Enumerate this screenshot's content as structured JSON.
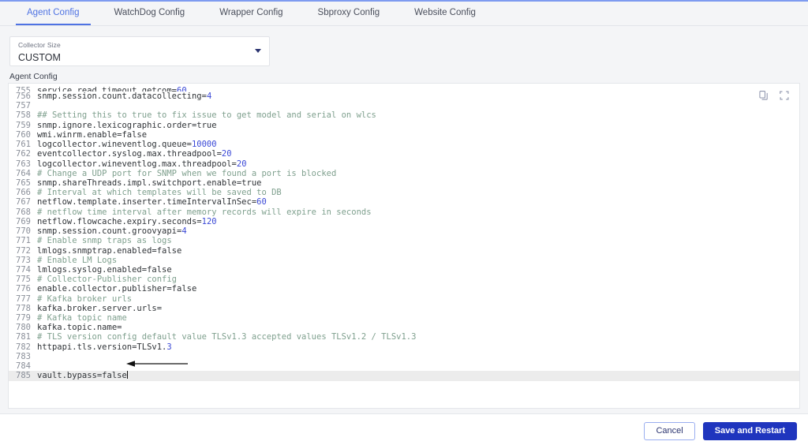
{
  "accent": {
    "blue": "#4f73e3",
    "primary_button": "#1f35be",
    "comment_green": "#7fa08e",
    "number_blue": "#3b49d6"
  },
  "tabs": [
    {
      "label": "Agent Config",
      "active": true
    },
    {
      "label": "WatchDog Config",
      "active": false
    },
    {
      "label": "Wrapper Config",
      "active": false
    },
    {
      "label": "Sbproxy Config",
      "active": false
    },
    {
      "label": "Website Config",
      "active": false
    }
  ],
  "collector_size": {
    "label": "Collector Size",
    "value": "CUSTOM",
    "options": [
      "CUSTOM"
    ]
  },
  "section": {
    "caption": "Agent Config"
  },
  "editor": {
    "tools": [
      {
        "name": "copy-icon",
        "title": "Copy"
      },
      {
        "name": "fullscreen-icon",
        "title": "Fullscreen"
      }
    ],
    "active_line": 785,
    "cursor_line": 785,
    "lines": [
      {
        "n": 755,
        "clipped": true,
        "segments": [
          {
            "t": "service.read_timeout_getcom=",
            "c": "code"
          },
          {
            "t": "60",
            "c": "num"
          }
        ]
      },
      {
        "n": 756,
        "segments": [
          {
            "t": "snmp.session.count.datacollecting=",
            "c": "code"
          },
          {
            "t": "4",
            "c": "num"
          }
        ]
      },
      {
        "n": 757,
        "segments": []
      },
      {
        "n": 758,
        "segments": [
          {
            "t": "## Setting this to true to fix issue to get model and serial on wlcs",
            "c": "cmt"
          }
        ]
      },
      {
        "n": 759,
        "segments": [
          {
            "t": "snmp.ignore.lexicographic.order=true",
            "c": "code"
          }
        ]
      },
      {
        "n": 760,
        "segments": [
          {
            "t": "wmi.winrm.enable=false",
            "c": "code"
          }
        ]
      },
      {
        "n": 761,
        "segments": [
          {
            "t": "logcollector.wineventlog.queue=",
            "c": "code"
          },
          {
            "t": "10000",
            "c": "num"
          }
        ]
      },
      {
        "n": 762,
        "segments": [
          {
            "t": "eventcollector.syslog.max.threadpool=",
            "c": "code"
          },
          {
            "t": "20",
            "c": "num"
          }
        ]
      },
      {
        "n": 763,
        "segments": [
          {
            "t": "logcollector.wineventlog.max.threadpool=",
            "c": "code"
          },
          {
            "t": "20",
            "c": "num"
          }
        ]
      },
      {
        "n": 764,
        "segments": [
          {
            "t": "# Change a UDP port for SNMP when we found a port is blocked",
            "c": "cmt"
          }
        ]
      },
      {
        "n": 765,
        "segments": [
          {
            "t": "snmp.shareThreads.impl.switchport.enable=true",
            "c": "code"
          }
        ]
      },
      {
        "n": 766,
        "segments": [
          {
            "t": "# Interval at which templates will be saved to DB",
            "c": "cmt"
          }
        ]
      },
      {
        "n": 767,
        "segments": [
          {
            "t": "netflow.template.inserter.timeIntervalInSec=",
            "c": "code"
          },
          {
            "t": "60",
            "c": "num"
          }
        ]
      },
      {
        "n": 768,
        "segments": [
          {
            "t": "# netflow time interval after memory records will expire in seconds",
            "c": "cmt"
          }
        ]
      },
      {
        "n": 769,
        "segments": [
          {
            "t": "netflow.flowcache.expiry.seconds=",
            "c": "code"
          },
          {
            "t": "120",
            "c": "num"
          }
        ]
      },
      {
        "n": 770,
        "segments": [
          {
            "t": "snmp.session.count.groovyapi=",
            "c": "code"
          },
          {
            "t": "4",
            "c": "num"
          }
        ]
      },
      {
        "n": 771,
        "segments": [
          {
            "t": "# Enable snmp traps as logs",
            "c": "cmt"
          }
        ]
      },
      {
        "n": 772,
        "segments": [
          {
            "t": "lmlogs.snmptrap.enabled=false",
            "c": "code"
          }
        ]
      },
      {
        "n": 773,
        "segments": [
          {
            "t": "# Enable LM Logs",
            "c": "cmt"
          }
        ]
      },
      {
        "n": 774,
        "segments": [
          {
            "t": "lmlogs.syslog.enabled=false",
            "c": "code"
          }
        ]
      },
      {
        "n": 775,
        "segments": [
          {
            "t": "# Collector-Publisher config",
            "c": "cmt"
          }
        ]
      },
      {
        "n": 776,
        "segments": [
          {
            "t": "enable.collector.publisher=false",
            "c": "code"
          }
        ]
      },
      {
        "n": 777,
        "segments": [
          {
            "t": "# Kafka broker urls",
            "c": "cmt"
          }
        ]
      },
      {
        "n": 778,
        "segments": [
          {
            "t": "kafka.broker.server.urls=",
            "c": "code"
          }
        ]
      },
      {
        "n": 779,
        "segments": [
          {
            "t": "# Kafka topic name",
            "c": "cmt"
          }
        ]
      },
      {
        "n": 780,
        "segments": [
          {
            "t": "kafka.topic.name=",
            "c": "code"
          }
        ]
      },
      {
        "n": 781,
        "segments": [
          {
            "t": "# TLS version config default value TLSv1.3 accepted values TLSv1.2 / TLSv1.3",
            "c": "cmt"
          }
        ]
      },
      {
        "n": 782,
        "segments": [
          {
            "t": "httpapi.tls.version=TLSv1.",
            "c": "code"
          },
          {
            "t": "3",
            "c": "num"
          }
        ]
      },
      {
        "n": 783,
        "segments": []
      },
      {
        "n": 784,
        "segments": []
      },
      {
        "n": 785,
        "highlight": true,
        "cursor": true,
        "segments": [
          {
            "t": "vault.bypass=false",
            "c": "code"
          }
        ]
      }
    ]
  },
  "annotation": {
    "name": "pointer-arrow",
    "direction": "left",
    "points_to": "vault.bypass=false"
  },
  "footer": {
    "cancel_label": "Cancel",
    "save_label": "Save and Restart"
  }
}
